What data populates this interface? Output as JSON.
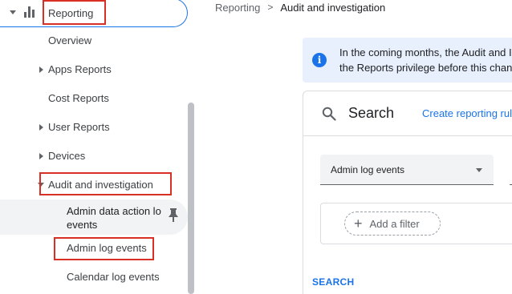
{
  "sidebar": {
    "reporting_label": "Reporting",
    "items": [
      {
        "label": "Overview"
      },
      {
        "label": "Apps Reports"
      },
      {
        "label": "Cost Reports"
      },
      {
        "label": "User Reports"
      },
      {
        "label": "Devices"
      },
      {
        "label": "Audit and investigation"
      }
    ],
    "subitems": [
      {
        "label_line1": "Admin data action lo",
        "label_line2": "events"
      },
      {
        "label": "Admin log events"
      },
      {
        "label": "Calendar log events"
      }
    ]
  },
  "breadcrumb": {
    "parent": "Reporting",
    "separator": ">",
    "current": "Audit and investigation"
  },
  "banner": {
    "line1": "In the coming months, the Audit and I",
    "line2": "the Reports privilege before this chan"
  },
  "search_card": {
    "title": "Search",
    "create_link": "Create reporting rule",
    "data_source": "Admin log events",
    "add_filter": "Add a filter",
    "search_button": "SEARCH"
  },
  "colors": {
    "accent": "#1a73e8",
    "highlight_border": "#d93025",
    "banner_bg": "#e8f0fe"
  }
}
